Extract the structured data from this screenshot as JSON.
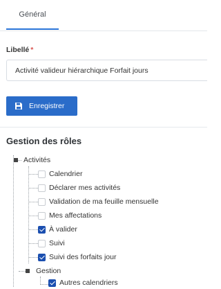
{
  "tabs": [
    {
      "label": "Général"
    }
  ],
  "form": {
    "label": "Libellé",
    "required_mark": "*",
    "value": "Activité valideur hiérarchique Forfait jours",
    "save_label": "Enregistrer"
  },
  "section": {
    "title": "Gestion des rôles"
  },
  "tree": {
    "root": "Activités",
    "items": [
      {
        "label": "Calendrier",
        "checked": false
      },
      {
        "label": "Déclarer mes activités",
        "checked": false
      },
      {
        "label": "Validation de ma feuille mensuelle",
        "checked": false
      },
      {
        "label": "Mes affectations",
        "checked": false
      },
      {
        "label": "À valider",
        "checked": true
      },
      {
        "label": "Suivi",
        "checked": false
      },
      {
        "label": "Suivi des forfaits jour",
        "checked": true
      }
    ],
    "group": "Gestion",
    "group_items": [
      {
        "label": "Autres calendriers",
        "checked": true
      }
    ]
  },
  "colors": {
    "accent": "#2a6cc9",
    "checkbox": "#1b4fb0",
    "required": "#d9534f"
  }
}
